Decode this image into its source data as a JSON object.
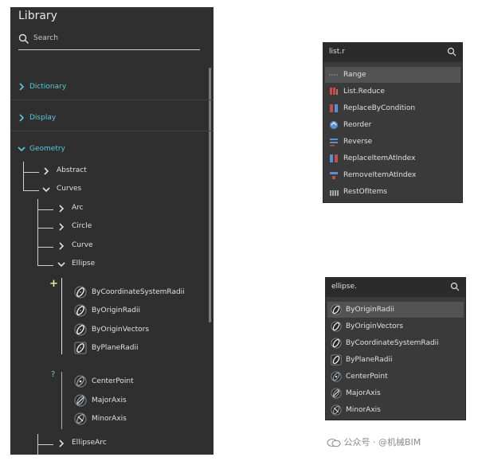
{
  "library": {
    "title": "Library",
    "search_placeholder": "Search",
    "categories": [
      {
        "label": "Dictionary",
        "expanded": false
      },
      {
        "label": "Display",
        "expanded": false
      },
      {
        "label": "Geometry",
        "expanded": true
      }
    ],
    "geometry_children": [
      {
        "label": "Abstract",
        "expanded": false
      },
      {
        "label": "Curves",
        "expanded": true
      }
    ],
    "curves_children": [
      {
        "label": "Arc",
        "expanded": false
      },
      {
        "label": "Circle",
        "expanded": false
      },
      {
        "label": "Curve",
        "expanded": false
      },
      {
        "label": "Ellipse",
        "expanded": true
      }
    ],
    "ellipse_create_marker": "+",
    "ellipse_create": [
      {
        "label": "ByCoordinateSystemRadii",
        "icon": "ellipse-icon"
      },
      {
        "label": "ByOriginRadii",
        "icon": "ellipse-icon"
      },
      {
        "label": "ByOriginVectors",
        "icon": "ellipse-icon"
      },
      {
        "label": "ByPlaneRadii",
        "icon": "ellipse-icon"
      }
    ],
    "ellipse_query_marker": "?",
    "ellipse_query": [
      {
        "label": "CenterPoint",
        "icon": "ellipse-center-icon"
      },
      {
        "label": "MajorAxis",
        "icon": "ellipse-axis-icon"
      },
      {
        "label": "MinorAxis",
        "icon": "ellipse-axis-icon"
      }
    ],
    "next_node": {
      "label": "EllipseArc",
      "expanded": false
    }
  },
  "search_list": {
    "query": "list.r",
    "results": [
      {
        "label": "Range",
        "icon": "range-icon",
        "selected": true
      },
      {
        "label": "List.Reduce",
        "icon": "reduce-icon",
        "selected": false
      },
      {
        "label": "ReplaceByCondition",
        "icon": "replace-condition-icon",
        "selected": false
      },
      {
        "label": "Reorder",
        "icon": "reorder-icon",
        "selected": false
      },
      {
        "label": "Reverse",
        "icon": "reverse-icon",
        "selected": false
      },
      {
        "label": "ReplaceItemAtIndex",
        "icon": "replace-index-icon",
        "selected": false
      },
      {
        "label": "RemoveItemAtIndex",
        "icon": "remove-index-icon",
        "selected": false
      },
      {
        "label": "RestOfItems",
        "icon": "rest-items-icon",
        "selected": false
      }
    ]
  },
  "search_ellipse": {
    "query": "ellipse.",
    "results": [
      {
        "label": "ByOriginRadii",
        "icon": "ellipse-icon",
        "selected": true
      },
      {
        "label": "ByOriginVectors",
        "icon": "ellipse-icon",
        "selected": false
      },
      {
        "label": "ByCoordinateSystemRadii",
        "icon": "ellipse-icon",
        "selected": false
      },
      {
        "label": "ByPlaneRadii",
        "icon": "ellipse-icon",
        "selected": false
      },
      {
        "label": "CenterPoint",
        "icon": "ellipse-center-icon",
        "selected": false
      },
      {
        "label": "MajorAxis",
        "icon": "ellipse-axis-icon",
        "selected": false
      },
      {
        "label": "MinorAxis",
        "icon": "ellipse-axis-icon",
        "selected": false
      }
    ]
  },
  "watermark": {
    "text": "公众号 · @机械BIM"
  },
  "colors": {
    "panel_bg": "#2f2f2f",
    "category_text": "#5fc9d6",
    "create_group": "#f3ed9e",
    "query_group": "#7fc3d6",
    "selected_row": "#525252"
  }
}
